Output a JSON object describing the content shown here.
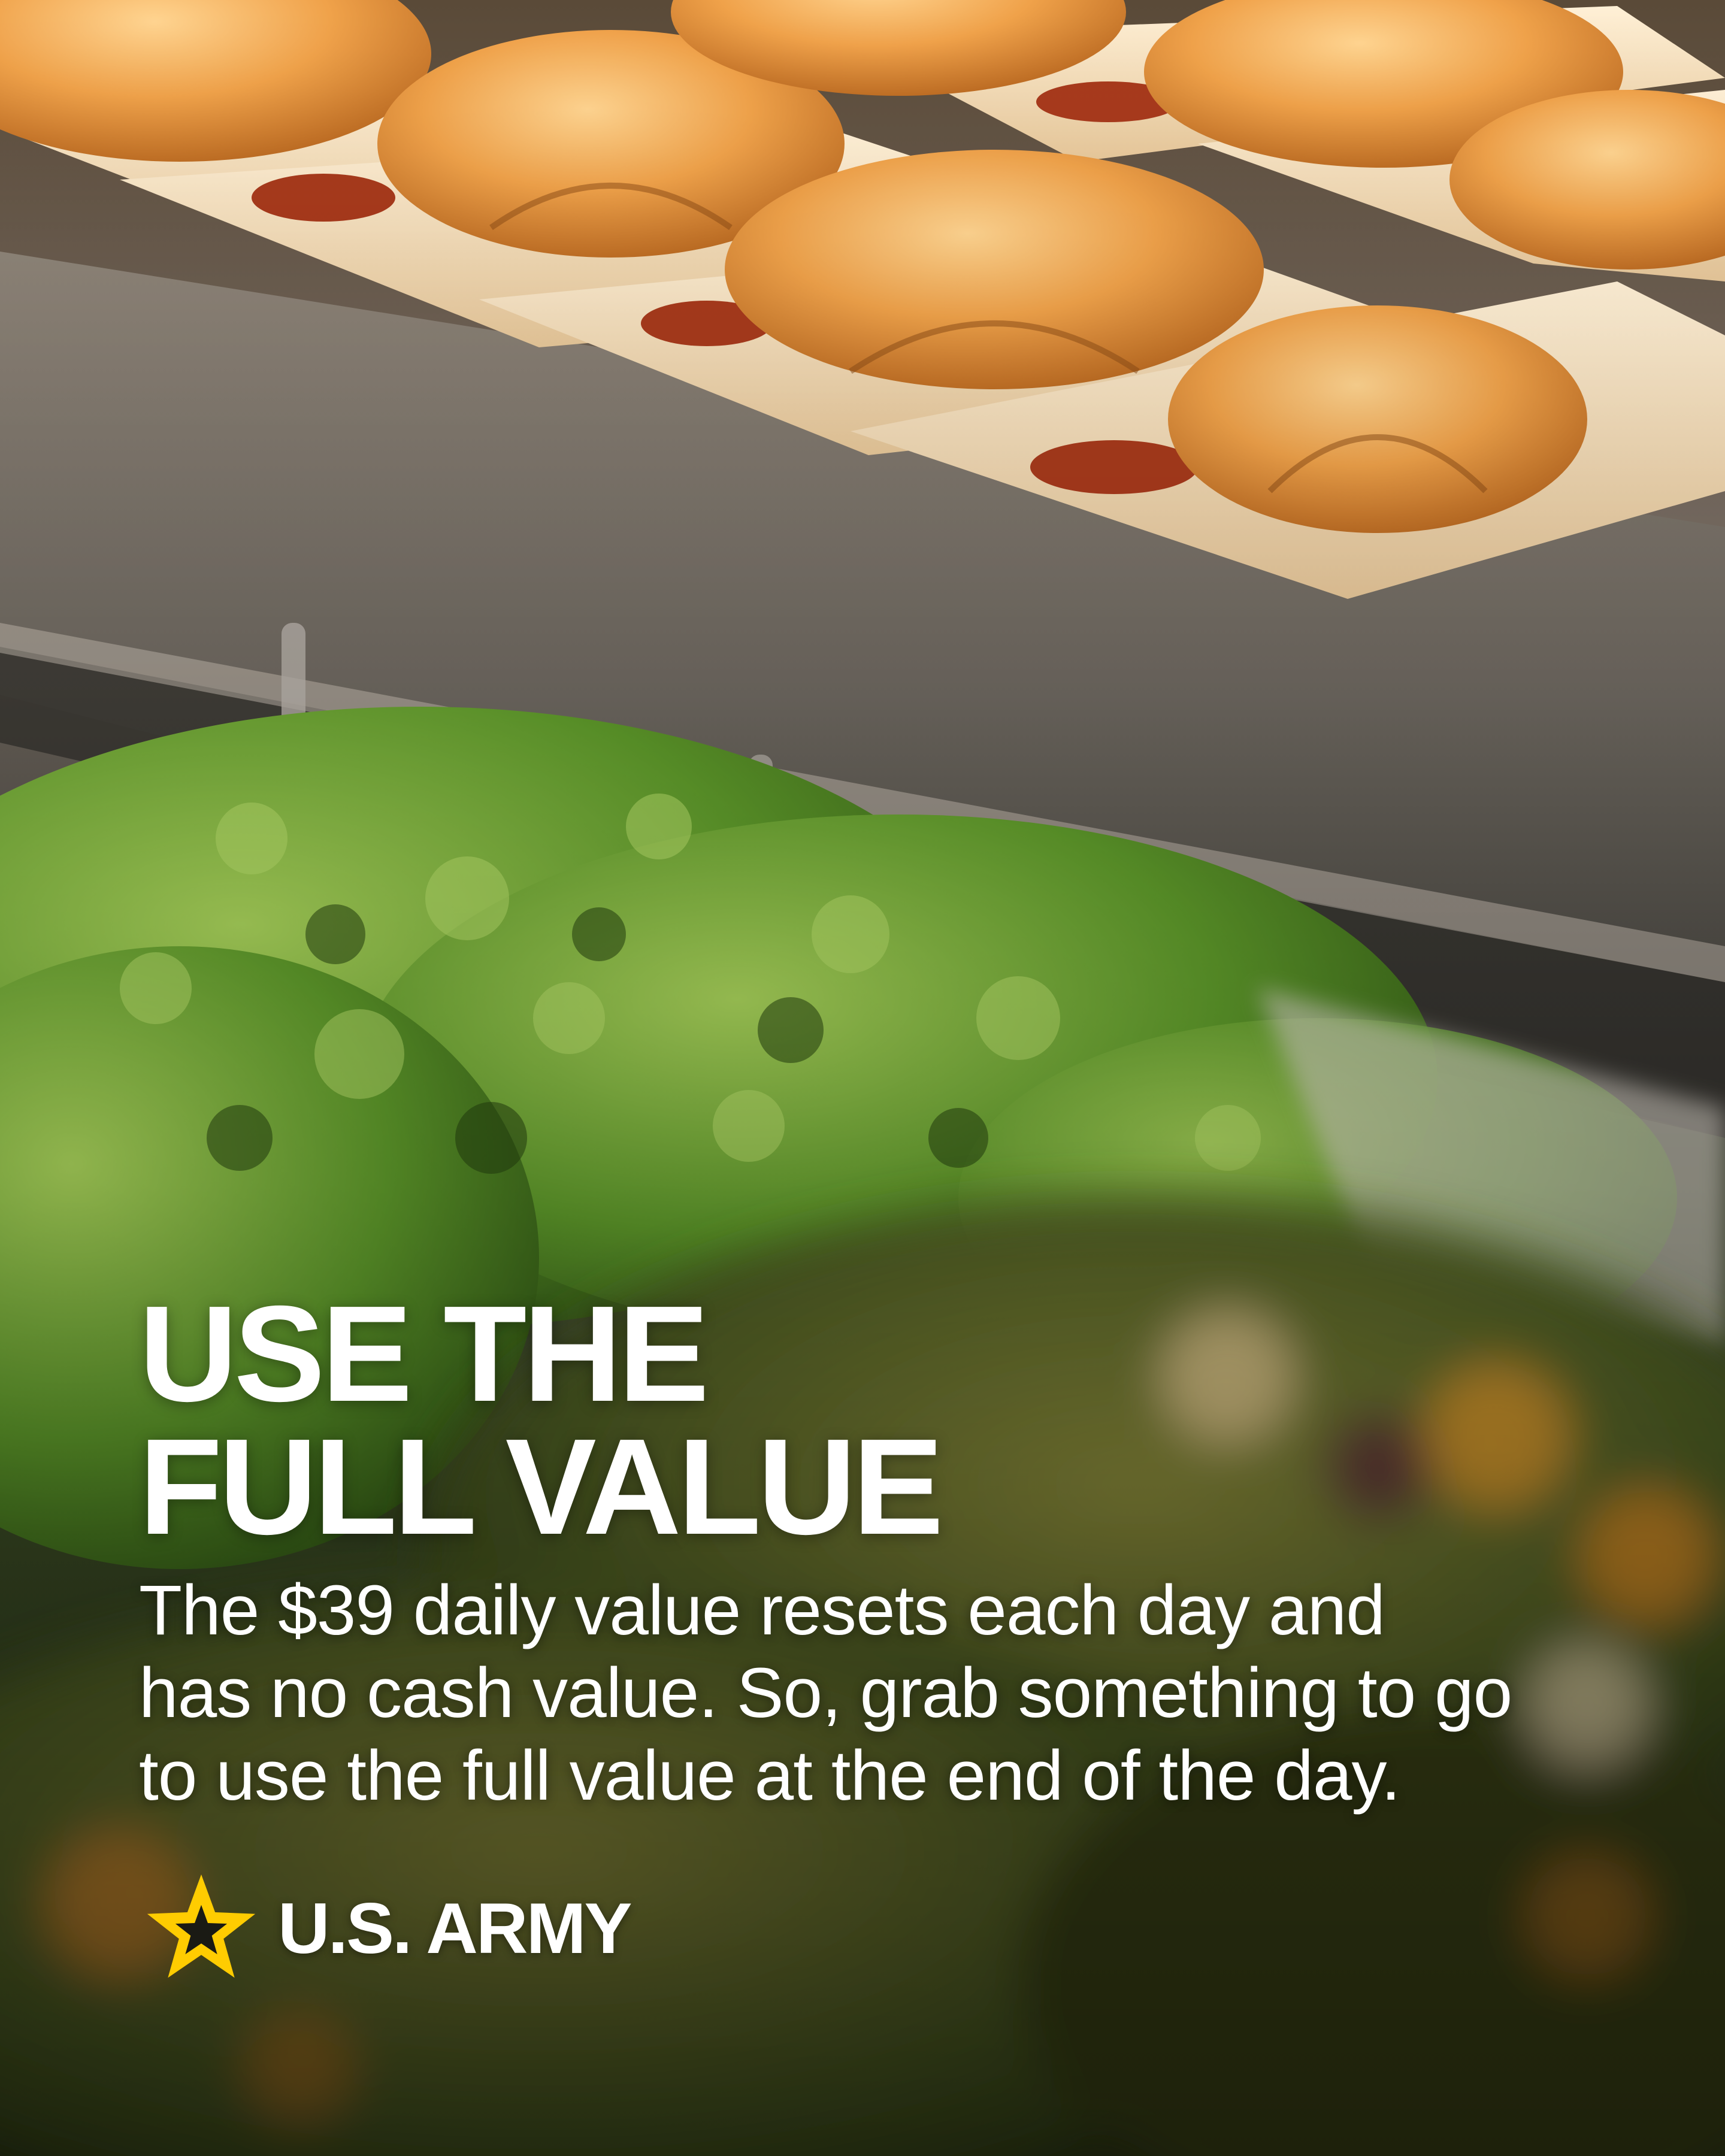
{
  "headline": {
    "line1": "USE THE",
    "line2": "FULL VALUE"
  },
  "body": {
    "line1": "The $39 daily value resets each day and",
    "line2": "has no cash value. So, grab something to go",
    "line3": "to use the full value at the end of the day."
  },
  "brand": {
    "name": "U.S. ARMY",
    "star_icon": "star-icon",
    "star_color": "#FFCC01"
  },
  "photo": {
    "subject_icons": [
      "bread-roll-tray",
      "kale-greens",
      "salad-bowl"
    ]
  }
}
